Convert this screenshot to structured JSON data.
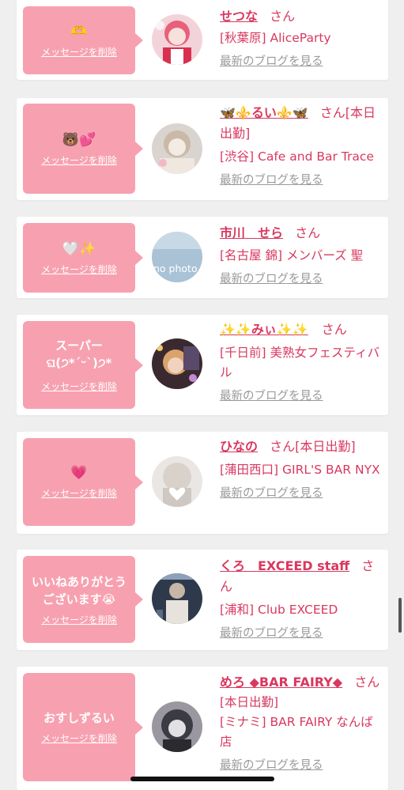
{
  "delete_label": "メッセージを削除",
  "blog_label": "最新のブログを見る",
  "cards": [
    {
      "message": "🫶",
      "message_is_emoji": true,
      "name": "せつな",
      "honorific": "さん",
      "shop": "[秋葉原] AliceParty",
      "avatar_icon": "girl-cosplay-avatar",
      "avatar_colors": [
        "#f5c6d0",
        "#e8607c",
        "#ffffff"
      ]
    },
    {
      "message": "🐻💕",
      "message_is_emoji": true,
      "name": "🦋⚜️るい⚜️🦋",
      "honorific": "さん[本日出勤]",
      "shop": "[渋谷] Cafe and Bar Trace",
      "avatar_icon": "blonde-girl-avatar",
      "avatar_colors": [
        "#dcd6cf",
        "#b7a99a",
        "#f2ede8"
      ]
    },
    {
      "message": "🤍✨",
      "message_is_emoji": true,
      "name": "市川　せら",
      "honorific": "さん",
      "shop": "[名古屋 錦] メンバーズ 聖",
      "avatar_icon": "no-photo-avatar",
      "avatar_label": "no photo",
      "avatar_colors": [
        "#a9c2d6",
        "#c8d9e6"
      ]
    },
    {
      "message": "スーパー\nଘ(੭*ˊᵕˋ)੭*",
      "message_is_emoji": false,
      "name": "✨✨みぃ✨✨",
      "honorific": "さん",
      "shop": "[千日前] 美熟女フェスティバル",
      "avatar_icon": "woman-selfie-avatar",
      "avatar_colors": [
        "#3a2a2f",
        "#d9a36b",
        "#7a5c8a"
      ]
    },
    {
      "message": "💗",
      "message_is_emoji": true,
      "name": "ひなの",
      "honorific": "さん[本日出勤]",
      "shop": "[蒲田西口] GIRL'S BAR NYX",
      "avatar_icon": "blonde-heart-avatar",
      "avatar_colors": [
        "#e9e6e4",
        "#cfc8c2",
        "#ffffff"
      ]
    },
    {
      "message": "いいねありがとう\nございます😭",
      "message_is_emoji": false,
      "name": "くろ　EXCEED staff",
      "honorific": "さん",
      "shop": "[浦和] Club EXCEED",
      "avatar_icon": "man-photo-avatar",
      "avatar_colors": [
        "#2e3a4c",
        "#c7b6a5",
        "#8fa0b8"
      ]
    },
    {
      "message": "おすしずるい",
      "message_is_emoji": false,
      "name": "めろ ◆BAR FAIRY◆",
      "honorific": "さん",
      "shop": "[本日出勤]\n[ミナミ] BAR FAIRY なんば店",
      "avatar_icon": "dark-hair-girl-avatar",
      "avatar_colors": [
        "#3b3b44",
        "#9a97a0",
        "#e2e0e4"
      ]
    }
  ]
}
